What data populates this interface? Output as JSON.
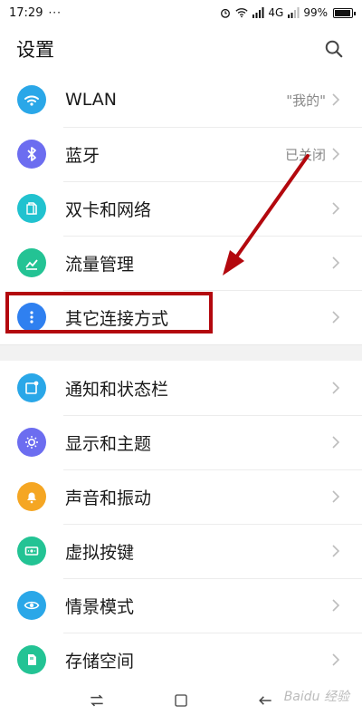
{
  "status_bar": {
    "time": "17:29",
    "dots": "···",
    "network": "4G",
    "battery": "99%",
    "battery_level": 0.99
  },
  "header": {
    "title": "设置",
    "search_icon": "search-icon"
  },
  "group1": [
    {
      "label": "WLAN",
      "value": "\"我的\"",
      "icon": "wifi-icon",
      "color": "#2aa7e8"
    },
    {
      "label": "蓝牙",
      "value": "已关闭",
      "icon": "bluetooth-icon",
      "color": "#6c6df0"
    },
    {
      "label": "双卡和网络",
      "value": "",
      "icon": "sim-card-icon",
      "color": "#21c2cf"
    },
    {
      "label": "流量管理",
      "value": "",
      "icon": "data-usage-icon",
      "color": "#23c394"
    },
    {
      "label": "其它连接方式",
      "value": "",
      "icon": "more-icon",
      "color": "#2f80f0"
    }
  ],
  "group2": [
    {
      "label": "通知和状态栏",
      "icon": "notification-icon",
      "color": "#2aa7e8"
    },
    {
      "label": "显示和主题",
      "icon": "brightness-icon",
      "color": "#6c6df0"
    },
    {
      "label": "声音和振动",
      "icon": "bell-icon",
      "color": "#f5a623"
    },
    {
      "label": "虚拟按键",
      "icon": "virtual-keys-icon",
      "color": "#23c394"
    },
    {
      "label": "情景模式",
      "icon": "eye-icon",
      "color": "#2aa7e8"
    },
    {
      "label": "存储空间",
      "icon": "storage-icon",
      "color": "#23c394"
    }
  ],
  "nav": {
    "back_icon": "swap-icon",
    "home_icon": "home-square-icon",
    "recent_icon": "back-arrow-icon"
  },
  "watermark": "Baidu 经验",
  "annotation_color": "#b3080e"
}
